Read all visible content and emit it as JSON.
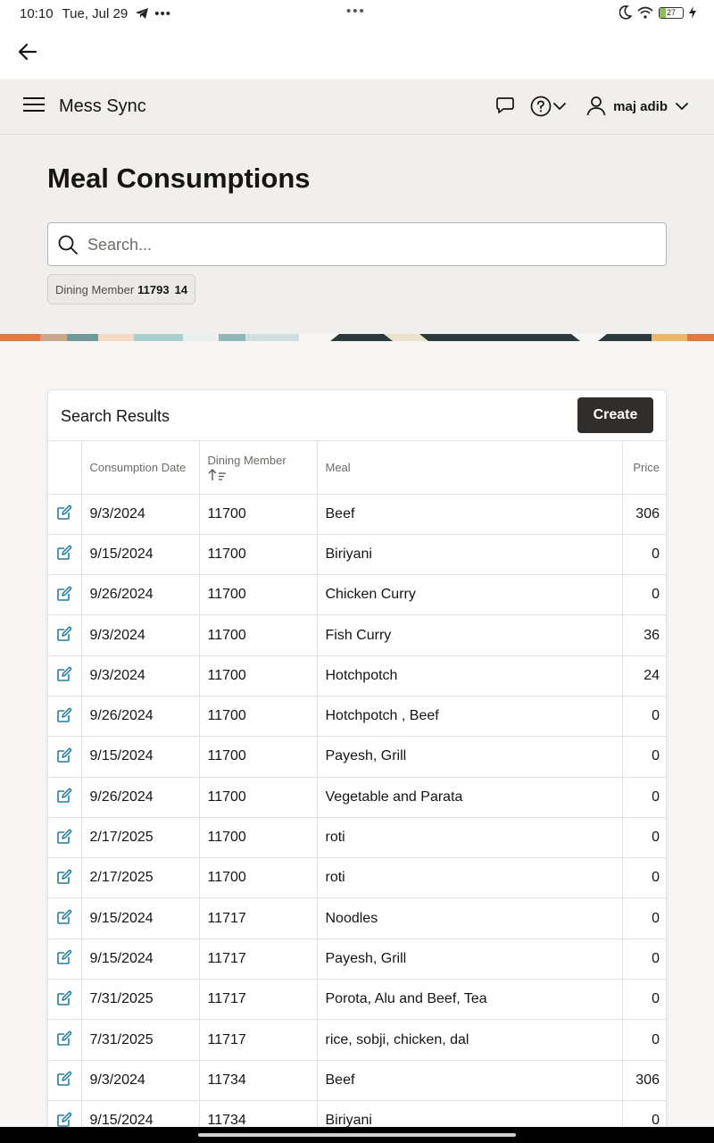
{
  "status_bar": {
    "time": "10:10",
    "date": "Tue, Jul 29",
    "overflow": "•••",
    "center_dots": "•••",
    "battery": "27"
  },
  "app": {
    "title": "Mess Sync",
    "user": "maj adib"
  },
  "page": {
    "title": "Meal Consumptions",
    "search_placeholder": "Search...",
    "filter": {
      "label": "Dining Member",
      "value": "11793",
      "count": "14"
    }
  },
  "results": {
    "title": "Search Results",
    "create_label": "Create",
    "columns": {
      "date": "Consumption Date",
      "member": "Dining Member",
      "meal": "Meal",
      "price": "Price"
    },
    "rows": [
      {
        "date": "9/3/2024",
        "member": "11700",
        "meal": "Beef",
        "price": "306"
      },
      {
        "date": "9/15/2024",
        "member": "11700",
        "meal": "Biriyani",
        "price": "0"
      },
      {
        "date": "9/26/2024",
        "member": "11700",
        "meal": "Chicken Curry",
        "price": "0"
      },
      {
        "date": "9/3/2024",
        "member": "11700",
        "meal": "Fish Curry",
        "price": "36"
      },
      {
        "date": "9/3/2024",
        "member": "11700",
        "meal": "Hotchpotch",
        "price": "24"
      },
      {
        "date": "9/26/2024",
        "member": "11700",
        "meal": "Hotchpotch , Beef",
        "price": "0"
      },
      {
        "date": "9/15/2024",
        "member": "11700",
        "meal": "Payesh, Grill",
        "price": "0"
      },
      {
        "date": "9/26/2024",
        "member": "11700",
        "meal": "Vegetable and Parata",
        "price": "0"
      },
      {
        "date": "2/17/2025",
        "member": "11700",
        "meal": "roti",
        "price": "0"
      },
      {
        "date": "2/17/2025",
        "member": "11700",
        "meal": "roti",
        "price": "0"
      },
      {
        "date": "9/15/2024",
        "member": "11717",
        "meal": "Noodles",
        "price": "0"
      },
      {
        "date": "9/15/2024",
        "member": "11717",
        "meal": "Payesh, Grill",
        "price": "0"
      },
      {
        "date": "7/31/2025",
        "member": "11717",
        "meal": "Porota, Alu and Beef, Tea",
        "price": "0"
      },
      {
        "date": "7/31/2025",
        "member": "11717",
        "meal": "rice, sobji, chicken, dal",
        "price": "0"
      },
      {
        "date": "9/3/2024",
        "member": "11734",
        "meal": "Beef",
        "price": "306"
      },
      {
        "date": "9/15/2024",
        "member": "11734",
        "meal": "Biriyani",
        "price": "0"
      }
    ]
  },
  "icons": {
    "back": "arrow-left-icon",
    "menu": "hamburger-icon",
    "chat": "chat-bubble-icon",
    "help": "help-circle-icon",
    "user": "user-icon",
    "search": "search-icon",
    "edit": "edit-icon",
    "sort": "sort-ascending-icon"
  },
  "colors": {
    "primary_button": "#312d2a",
    "edit_icon": "#227e9e",
    "header_bg": "#f1efed"
  }
}
